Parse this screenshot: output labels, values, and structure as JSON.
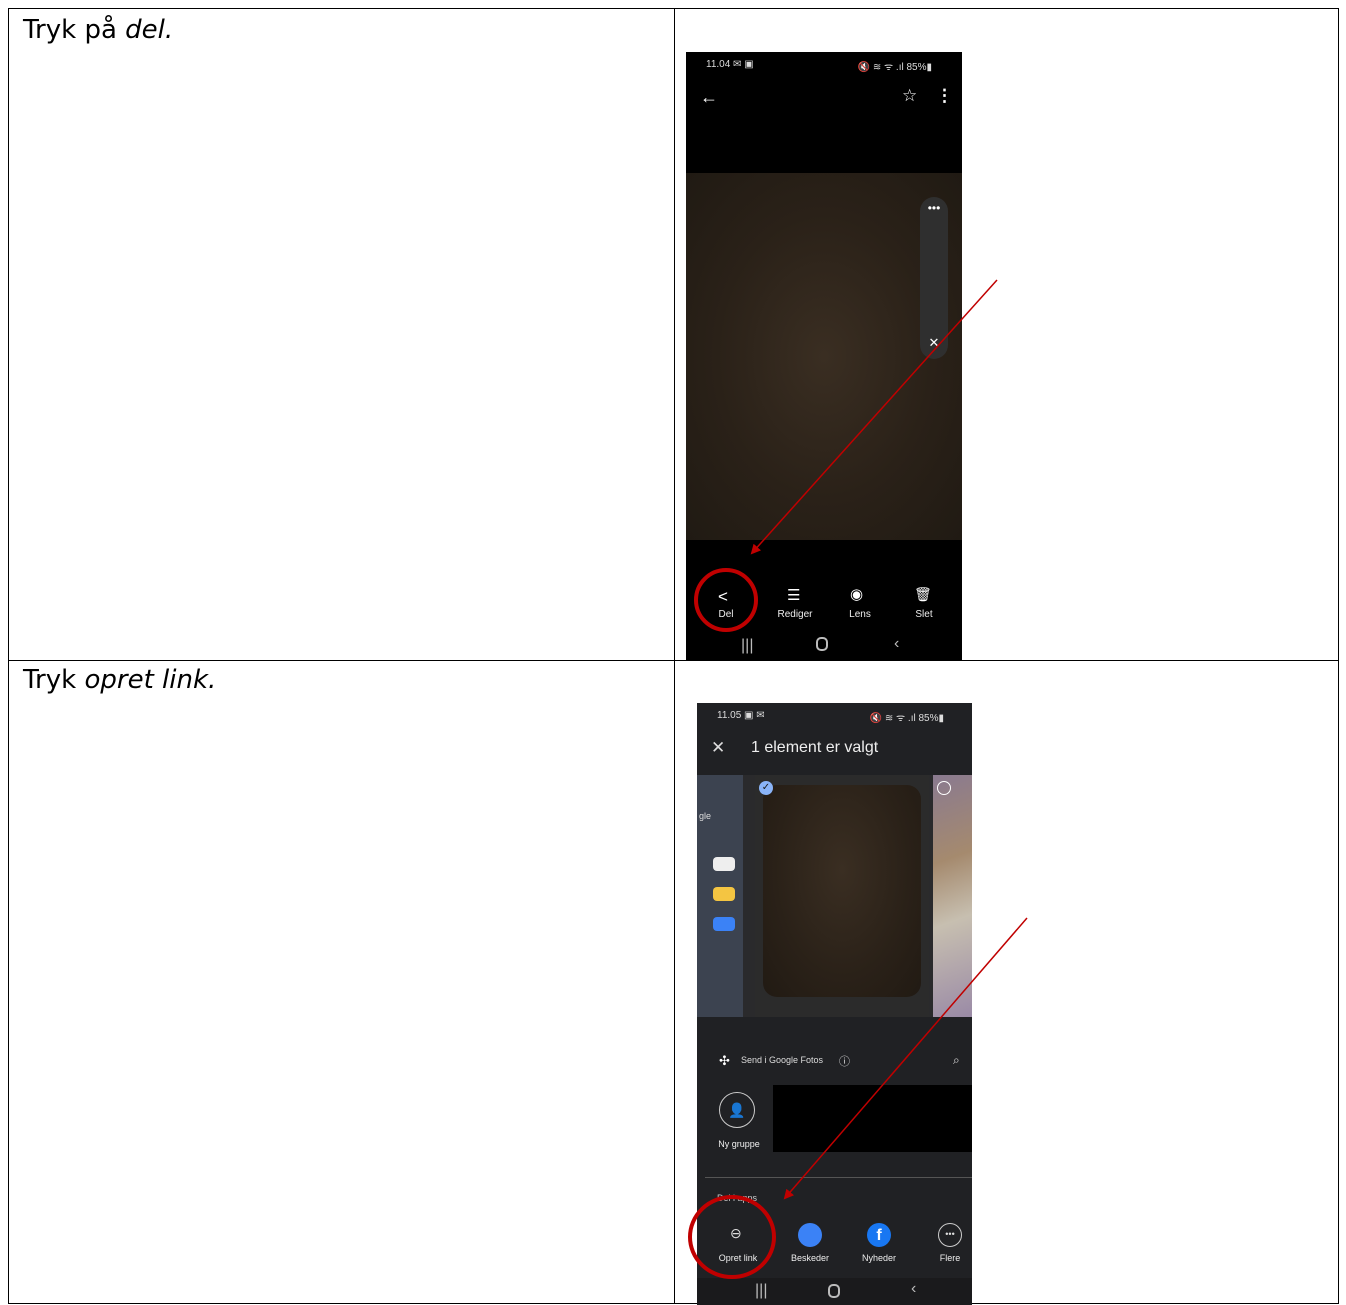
{
  "rows": [
    {
      "instruction": {
        "prefix": "Tryk på ",
        "emphasis": "del."
      },
      "phone": {
        "status_time": "11.04 ✉ ▣",
        "status_right": "🔇 ≋ ᯤ .ıl 85%▮",
        "back_icon": "arrow-left-icon",
        "toolbar": {
          "share": "Del",
          "edit": "Rediger",
          "lens": "Lens",
          "delete": "Slet"
        }
      }
    },
    {
      "instruction": {
        "prefix": "Tryk ",
        "emphasis": "opret link."
      },
      "phone": {
        "status_time": "11.05 ▣ ✉",
        "status_right": "🔇 ≋ ᯤ .ıl 85%▮",
        "header_title": "1 element er valgt",
        "google_photos_label": "Send i Google Fotos",
        "new_group": "Ny gruppe",
        "share_in_apps": "Del i apps",
        "apps": [
          "Opret link",
          "Beskeder",
          "Nyheder",
          "Flere"
        ],
        "left_thumb_text": "gle"
      }
    }
  ],
  "colors": {
    "annotation_red": "#c00000",
    "photo_brown": "#2a2118"
  }
}
